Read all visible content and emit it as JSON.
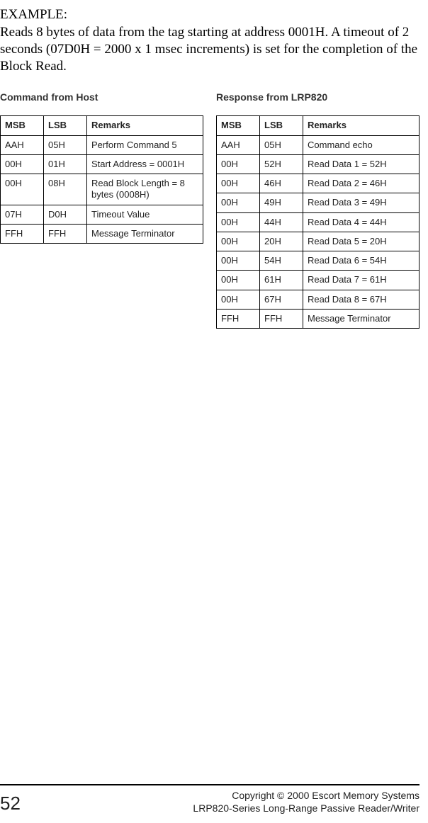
{
  "example_label": "EXAMPLE:",
  "example_body": "Reads 8 bytes of data from the tag starting at address 0001H. A timeout of 2 seconds (07D0H = 2000 x 1 msec increments) is set for the completion of the Block Read.",
  "left": {
    "title": "Command from Host",
    "headers": {
      "msb": "MSB",
      "lsb": "LSB",
      "remarks": "Remarks"
    },
    "rows": [
      {
        "msb": "AAH",
        "lsb": "05H",
        "remarks": "Perform Command 5"
      },
      {
        "msb": "00H",
        "lsb": "01H",
        "remarks": "Start Address = 0001H"
      },
      {
        "msb": "00H",
        "lsb": "08H",
        "remarks": "Read Block Length = 8 bytes (0008H)"
      },
      {
        "msb": "07H",
        "lsb": "D0H",
        "remarks": "Timeout Value"
      },
      {
        "msb": "FFH",
        "lsb": "FFH",
        "remarks": "Message Terminator"
      }
    ]
  },
  "right": {
    "title": "Response from LRP820",
    "headers": {
      "msb": "MSB",
      "lsb": "LSB",
      "remarks": "Remarks"
    },
    "rows": [
      {
        "msb": "AAH",
        "lsb": "05H",
        "remarks": "Command echo"
      },
      {
        "msb": "00H",
        "lsb": "52H",
        "remarks": "Read Data 1 = 52H"
      },
      {
        "msb": "00H",
        "lsb": "46H",
        "remarks": "Read Data 2 = 46H"
      },
      {
        "msb": "00H",
        "lsb": "49H",
        "remarks": "Read Data 3 = 49H"
      },
      {
        "msb": "00H",
        "lsb": "44H",
        "remarks": "Read Data 4 = 44H"
      },
      {
        "msb": "00H",
        "lsb": "20H",
        "remarks": "Read Data 5 = 20H"
      },
      {
        "msb": "00H",
        "lsb": "54H",
        "remarks": "Read Data 6 = 54H"
      },
      {
        "msb": "00H",
        "lsb": "61H",
        "remarks": "Read Data 7 = 61H"
      },
      {
        "msb": "00H",
        "lsb": "67H",
        "remarks": "Read Data 8 = 67H"
      },
      {
        "msb": "FFH",
        "lsb": "FFH",
        "remarks": "Message Terminator"
      }
    ]
  },
  "footer": {
    "page": "52",
    "line1": "Copyright © 2000 Escort Memory Systems",
    "line2": "LRP820-Series Long-Range Passive Reader/Writer"
  }
}
